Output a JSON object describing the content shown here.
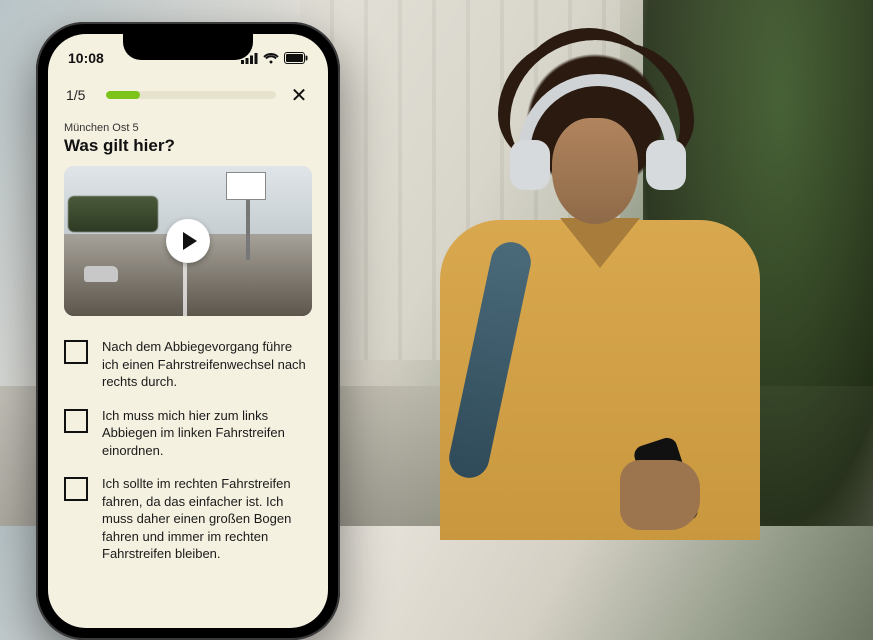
{
  "status": {
    "time": "10:08"
  },
  "header": {
    "progress_counter": "1/5",
    "progress_percent": 20,
    "close_label": "✕"
  },
  "lesson": {
    "label": "München Ost 5",
    "question": "Was gilt hier?"
  },
  "video": {
    "play_label": "Play"
  },
  "answers": [
    {
      "text": "Nach dem Abbiegevorgang führe ich einen Fahrstreifenwechsel nach rechts durch."
    },
    {
      "text": "Ich muss mich hier zum links Abbiegen im linken Fahrstreifen einordnen."
    },
    {
      "text": "Ich sollte im rechten Fahrstreifen fahren, da das einfacher ist. Ich muss daher einen großen Bogen fahren und immer im rechten Fahrstreifen bleiben."
    }
  ],
  "colors": {
    "accent": "#7cc31a",
    "screen_bg": "#f5f1e1"
  }
}
